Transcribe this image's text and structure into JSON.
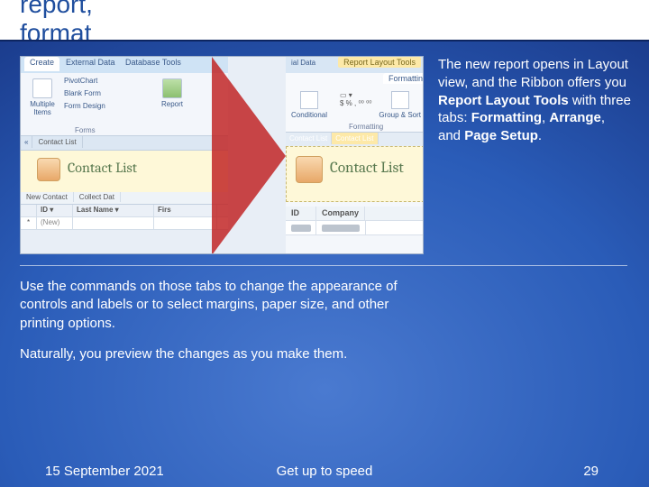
{
  "title": "Create a report, format a report",
  "right_text": {
    "p1a": "The new report opens in Layout view, and the Ribbon offers you ",
    "b1": "Report Layout Tools",
    "p1b": " with three tabs: ",
    "b2": "Formatting",
    "c1": ", ",
    "b3": "Arrange",
    "c2": ", and ",
    "b4": "Page Setup",
    "c3": "."
  },
  "lower": {
    "p1": "Use the commands on those tabs to change the appearance of controls and labels or to select margins, paper size, and other printing options.",
    "p2": "Naturally, you preview the changes as you make them."
  },
  "footer": {
    "date": "15 September 2021",
    "mid": "Get up to speed",
    "page": "29"
  },
  "mock": {
    "left": {
      "tabs": [
        "Create",
        "External Data",
        "Database Tools"
      ],
      "buttons": {
        "multiple": "Multiple\nItems",
        "pivot": "PivotChart",
        "blank": "Blank Form",
        "design": "Form\nDesign",
        "report": "Report"
      },
      "group": "Forms",
      "open_tabs": {
        "chev": "«",
        "t1": "Contact List"
      },
      "header": "Contact List",
      "toolbar2": [
        "New Contact",
        "Collect Dat"
      ],
      "grid_hdr": [
        "",
        "ID ▾",
        "Last Name ▾",
        "Firs"
      ],
      "grid_row": [
        "*",
        "(New)",
        "",
        ""
      ]
    },
    "right": {
      "pre": "ial Data",
      "context": "Report Layout Tools",
      "tab": "Formatting",
      "cond": "Conditional",
      "fmt": "$ % , ⁰⁰ ⁰⁰",
      "gs": "Group\n& Sort",
      "lab1": "Formatting",
      "tabs2": {
        "t1": "Contact List",
        "t2": "Contact List"
      },
      "header": "Contact List",
      "grid_hdr": [
        "ID",
        "Company"
      ]
    }
  }
}
